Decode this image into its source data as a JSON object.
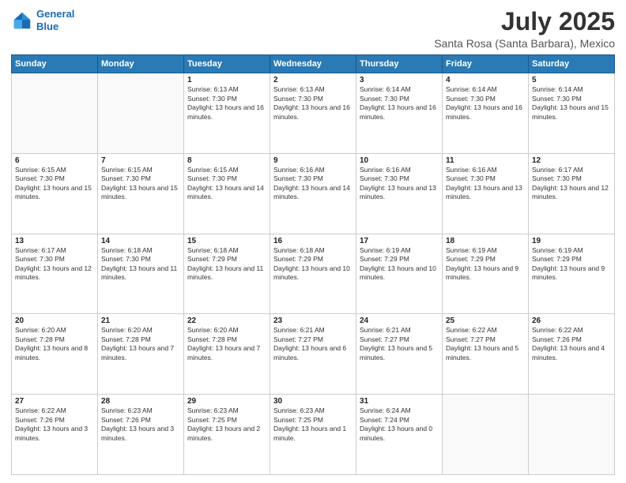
{
  "header": {
    "logo_line1": "General",
    "logo_line2": "Blue",
    "title": "July 2025",
    "subtitle": "Santa Rosa (Santa Barbara), Mexico"
  },
  "calendar": {
    "days_of_week": [
      "Sunday",
      "Monday",
      "Tuesday",
      "Wednesday",
      "Thursday",
      "Friday",
      "Saturday"
    ],
    "weeks": [
      [
        {
          "day": "",
          "info": ""
        },
        {
          "day": "",
          "info": ""
        },
        {
          "day": "1",
          "info": "Sunrise: 6:13 AM\nSunset: 7:30 PM\nDaylight: 13 hours and 16 minutes."
        },
        {
          "day": "2",
          "info": "Sunrise: 6:13 AM\nSunset: 7:30 PM\nDaylight: 13 hours and 16 minutes."
        },
        {
          "day": "3",
          "info": "Sunrise: 6:14 AM\nSunset: 7:30 PM\nDaylight: 13 hours and 16 minutes."
        },
        {
          "day": "4",
          "info": "Sunrise: 6:14 AM\nSunset: 7:30 PM\nDaylight: 13 hours and 16 minutes."
        },
        {
          "day": "5",
          "info": "Sunrise: 6:14 AM\nSunset: 7:30 PM\nDaylight: 13 hours and 15 minutes."
        }
      ],
      [
        {
          "day": "6",
          "info": "Sunrise: 6:15 AM\nSunset: 7:30 PM\nDaylight: 13 hours and 15 minutes."
        },
        {
          "day": "7",
          "info": "Sunrise: 6:15 AM\nSunset: 7:30 PM\nDaylight: 13 hours and 15 minutes."
        },
        {
          "day": "8",
          "info": "Sunrise: 6:15 AM\nSunset: 7:30 PM\nDaylight: 13 hours and 14 minutes."
        },
        {
          "day": "9",
          "info": "Sunrise: 6:16 AM\nSunset: 7:30 PM\nDaylight: 13 hours and 14 minutes."
        },
        {
          "day": "10",
          "info": "Sunrise: 6:16 AM\nSunset: 7:30 PM\nDaylight: 13 hours and 13 minutes."
        },
        {
          "day": "11",
          "info": "Sunrise: 6:16 AM\nSunset: 7:30 PM\nDaylight: 13 hours and 13 minutes."
        },
        {
          "day": "12",
          "info": "Sunrise: 6:17 AM\nSunset: 7:30 PM\nDaylight: 13 hours and 12 minutes."
        }
      ],
      [
        {
          "day": "13",
          "info": "Sunrise: 6:17 AM\nSunset: 7:30 PM\nDaylight: 13 hours and 12 minutes."
        },
        {
          "day": "14",
          "info": "Sunrise: 6:18 AM\nSunset: 7:30 PM\nDaylight: 13 hours and 11 minutes."
        },
        {
          "day": "15",
          "info": "Sunrise: 6:18 AM\nSunset: 7:29 PM\nDaylight: 13 hours and 11 minutes."
        },
        {
          "day": "16",
          "info": "Sunrise: 6:18 AM\nSunset: 7:29 PM\nDaylight: 13 hours and 10 minutes."
        },
        {
          "day": "17",
          "info": "Sunrise: 6:19 AM\nSunset: 7:29 PM\nDaylight: 13 hours and 10 minutes."
        },
        {
          "day": "18",
          "info": "Sunrise: 6:19 AM\nSunset: 7:29 PM\nDaylight: 13 hours and 9 minutes."
        },
        {
          "day": "19",
          "info": "Sunrise: 6:19 AM\nSunset: 7:29 PM\nDaylight: 13 hours and 9 minutes."
        }
      ],
      [
        {
          "day": "20",
          "info": "Sunrise: 6:20 AM\nSunset: 7:28 PM\nDaylight: 13 hours and 8 minutes."
        },
        {
          "day": "21",
          "info": "Sunrise: 6:20 AM\nSunset: 7:28 PM\nDaylight: 13 hours and 7 minutes."
        },
        {
          "day": "22",
          "info": "Sunrise: 6:20 AM\nSunset: 7:28 PM\nDaylight: 13 hours and 7 minutes."
        },
        {
          "day": "23",
          "info": "Sunrise: 6:21 AM\nSunset: 7:27 PM\nDaylight: 13 hours and 6 minutes."
        },
        {
          "day": "24",
          "info": "Sunrise: 6:21 AM\nSunset: 7:27 PM\nDaylight: 13 hours and 5 minutes."
        },
        {
          "day": "25",
          "info": "Sunrise: 6:22 AM\nSunset: 7:27 PM\nDaylight: 13 hours and 5 minutes."
        },
        {
          "day": "26",
          "info": "Sunrise: 6:22 AM\nSunset: 7:26 PM\nDaylight: 13 hours and 4 minutes."
        }
      ],
      [
        {
          "day": "27",
          "info": "Sunrise: 6:22 AM\nSunset: 7:26 PM\nDaylight: 13 hours and 3 minutes."
        },
        {
          "day": "28",
          "info": "Sunrise: 6:23 AM\nSunset: 7:26 PM\nDaylight: 13 hours and 3 minutes."
        },
        {
          "day": "29",
          "info": "Sunrise: 6:23 AM\nSunset: 7:25 PM\nDaylight: 13 hours and 2 minutes."
        },
        {
          "day": "30",
          "info": "Sunrise: 6:23 AM\nSunset: 7:25 PM\nDaylight: 13 hours and 1 minute."
        },
        {
          "day": "31",
          "info": "Sunrise: 6:24 AM\nSunset: 7:24 PM\nDaylight: 13 hours and 0 minutes."
        },
        {
          "day": "",
          "info": ""
        },
        {
          "day": "",
          "info": ""
        }
      ]
    ]
  }
}
